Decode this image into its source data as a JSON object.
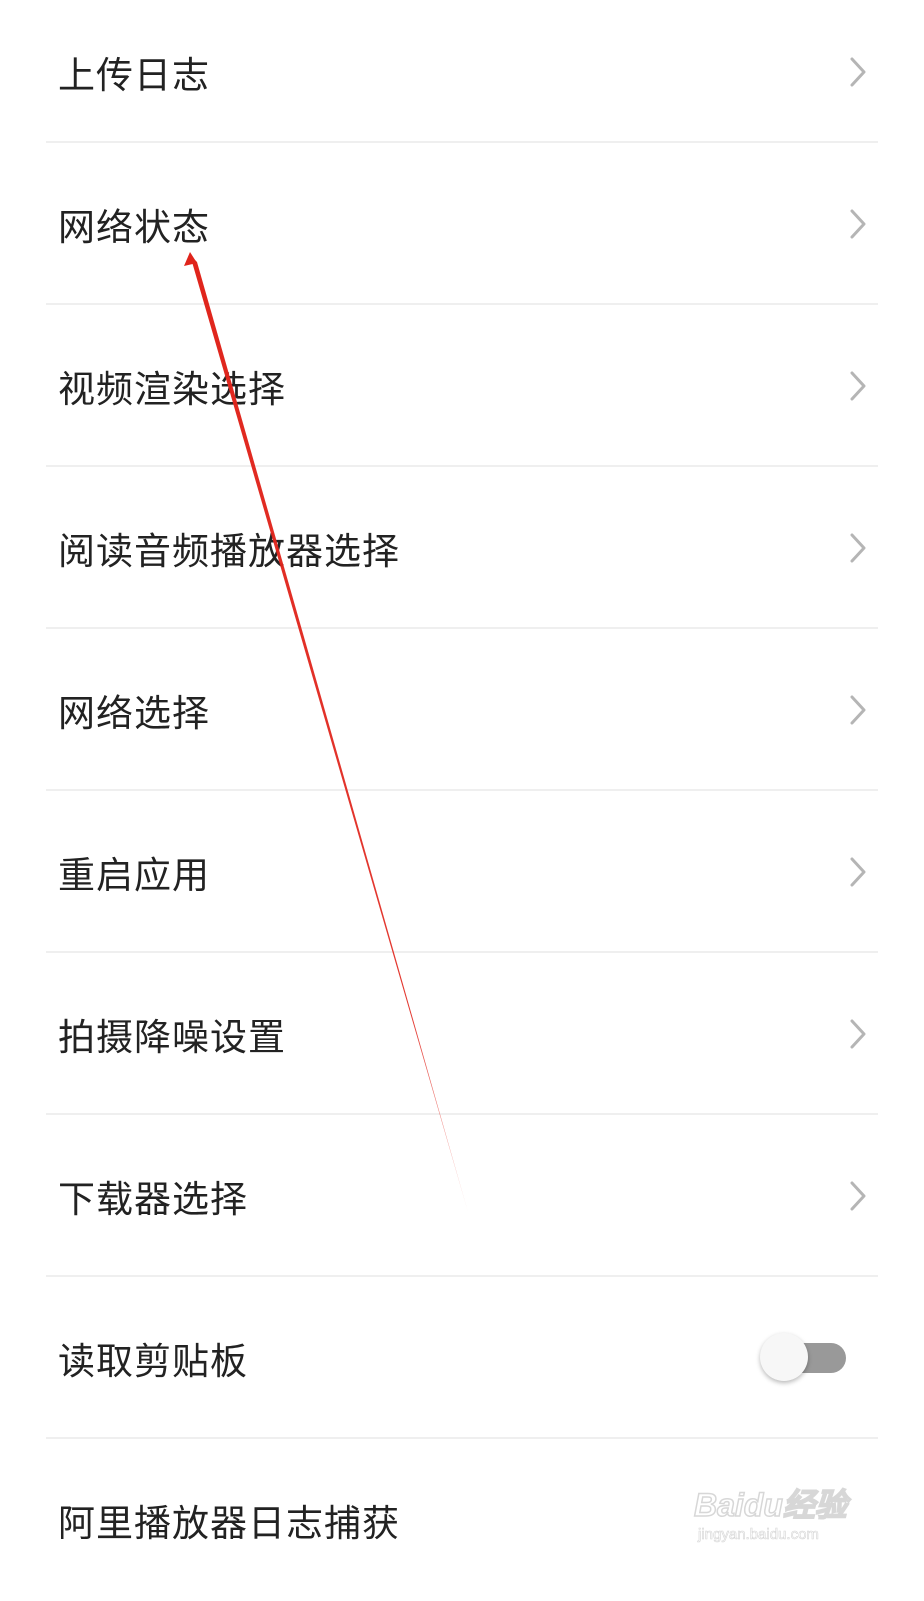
{
  "settings": {
    "items": [
      {
        "label": "上传日志",
        "control": "chevron-right-icon"
      },
      {
        "label": "网络状态",
        "control": "chevron-right-icon"
      },
      {
        "label": "视频渲染选择",
        "control": "chevron-right-icon"
      },
      {
        "label": "阅读音频播放器选择",
        "control": "chevron-right-icon"
      },
      {
        "label": "网络选择",
        "control": "chevron-right-icon"
      },
      {
        "label": "重启应用",
        "control": "chevron-right-icon"
      },
      {
        "label": "拍摄降噪设置",
        "control": "chevron-right-icon"
      },
      {
        "label": "下载器选择",
        "control": "chevron-right-icon"
      },
      {
        "label": "读取剪贴板",
        "control": "toggle",
        "toggle_on": false
      },
      {
        "label": "阿里播放器日志捕获",
        "control": "toggle"
      }
    ]
  },
  "annotation": {
    "arrow_color": "#e0241b",
    "points_to": "网络状态"
  },
  "watermark": {
    "brand": "Baidu经验",
    "url": "jingyan.baidu.com"
  },
  "colors": {
    "label": "#222222",
    "divider": "#efefef",
    "chevron": "#b5b5b5",
    "toggle_track_off": "#999999"
  }
}
